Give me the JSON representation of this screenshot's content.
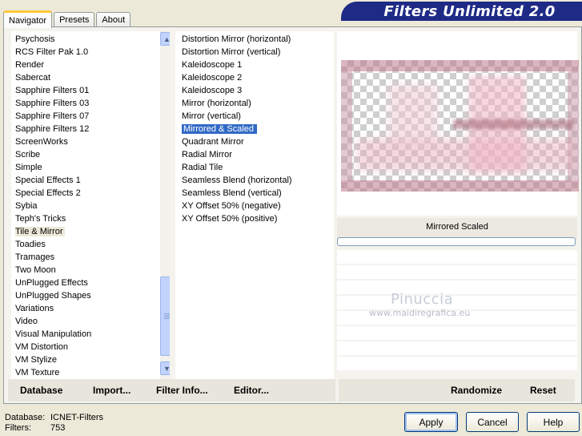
{
  "tabs": [
    "Navigator",
    "Presets",
    "About"
  ],
  "title": "Filters Unlimited 2.0",
  "categories": [
    "Psychosis",
    "RCS Filter Pak 1.0",
    "Render",
    "Sabercat",
    "Sapphire Filters 01",
    "Sapphire Filters 03",
    "Sapphire Filters 07",
    "Sapphire Filters 12",
    "ScreenWorks",
    "Scribe",
    "Simple",
    "Special Effects 1",
    "Special Effects 2",
    "Sybia",
    "Teph's Tricks",
    "Tile & Mirror",
    "Toadies",
    "Tramages",
    "Two Moon",
    "UnPlugged Effects",
    "UnPlugged Shapes",
    "Variations",
    "Video",
    "Visual Manipulation",
    "VM Distortion",
    "VM Stylize",
    "VM Texture"
  ],
  "selected_category": "Tile & Mirror",
  "filters": [
    "Distortion Mirror (horizontal)",
    "Distortion Mirror (vertical)",
    "Kaleidoscope 1",
    "Kaleidoscope 2",
    "Kaleidoscope 3",
    "Mirror (horizontal)",
    "Mirror (vertical)",
    "Mirrored & Scaled",
    "Quadrant Mirror",
    "Radial Mirror",
    "Radial Tile",
    "Seamless Blend (horizontal)",
    "Seamless Blend (vertical)",
    "XY Offset 50% (negative)",
    "XY Offset 50% (positive)"
  ],
  "selected_filter": "Mirrored & Scaled",
  "preview": {
    "filter_name": "Mirrored  Scaled",
    "progress": 0
  },
  "watermark": {
    "name": "Pinuccia",
    "site": "www.maidiregrafica.eu"
  },
  "toolbar": {
    "database": "Database",
    "import": "Import...",
    "filter_info": "Filter Info...",
    "editor": "Editor...",
    "randomize": "Randomize",
    "reset": "Reset"
  },
  "status": {
    "database_label": "Database:",
    "database_value": "ICNET-Filters",
    "filters_label": "Filters:",
    "filters_value": "753"
  },
  "buttons": {
    "apply": "Apply",
    "cancel": "Cancel",
    "help": "Help"
  },
  "colors": {
    "selection": "#316ac5",
    "banner": "#1e2a86",
    "face": "#ece9d8"
  }
}
